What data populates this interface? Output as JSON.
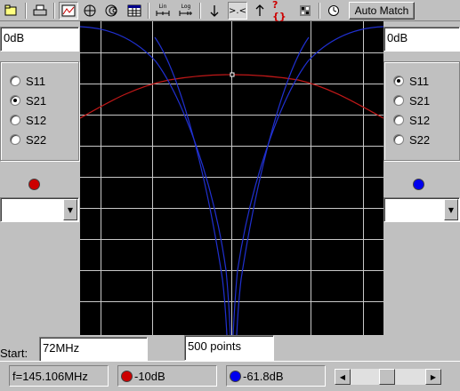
{
  "toolbar": {
    "auto_match_label": "Auto Match",
    "lin_label": "Lin",
    "log_label": "Log",
    "zoom_label": ">.<",
    "help_label": "?{}"
  },
  "left_panel": {
    "level_value": "0dB",
    "radios": [
      {
        "label": "S11",
        "checked": false
      },
      {
        "label": "S21",
        "checked": true
      },
      {
        "label": "S12",
        "checked": false
      },
      {
        "label": "S22",
        "checked": false
      }
    ],
    "marker_color": "#cc0000",
    "combo_value": ""
  },
  "right_panel": {
    "level_value": "0dB",
    "radios": [
      {
        "label": "S11",
        "checked": true
      },
      {
        "label": "S21",
        "checked": false
      },
      {
        "label": "S12",
        "checked": false
      },
      {
        "label": "S22",
        "checked": false
      }
    ],
    "marker_color": "#0000ee",
    "combo_value": ""
  },
  "sweep": {
    "start_label": "Start:",
    "start_value": "72MHz",
    "points_value": "500 points"
  },
  "status": {
    "frequency": "f=145.106MHz",
    "marker1_value": "-10dB",
    "marker1_color": "#cc0000",
    "marker2_value": "-61.8dB",
    "marker2_color": "#0000ee"
  },
  "colors": {
    "plot_background": "#000000",
    "grid": "#c8c8c8",
    "trace_s21": "#c01818",
    "trace_s11": "#2030d0"
  }
}
